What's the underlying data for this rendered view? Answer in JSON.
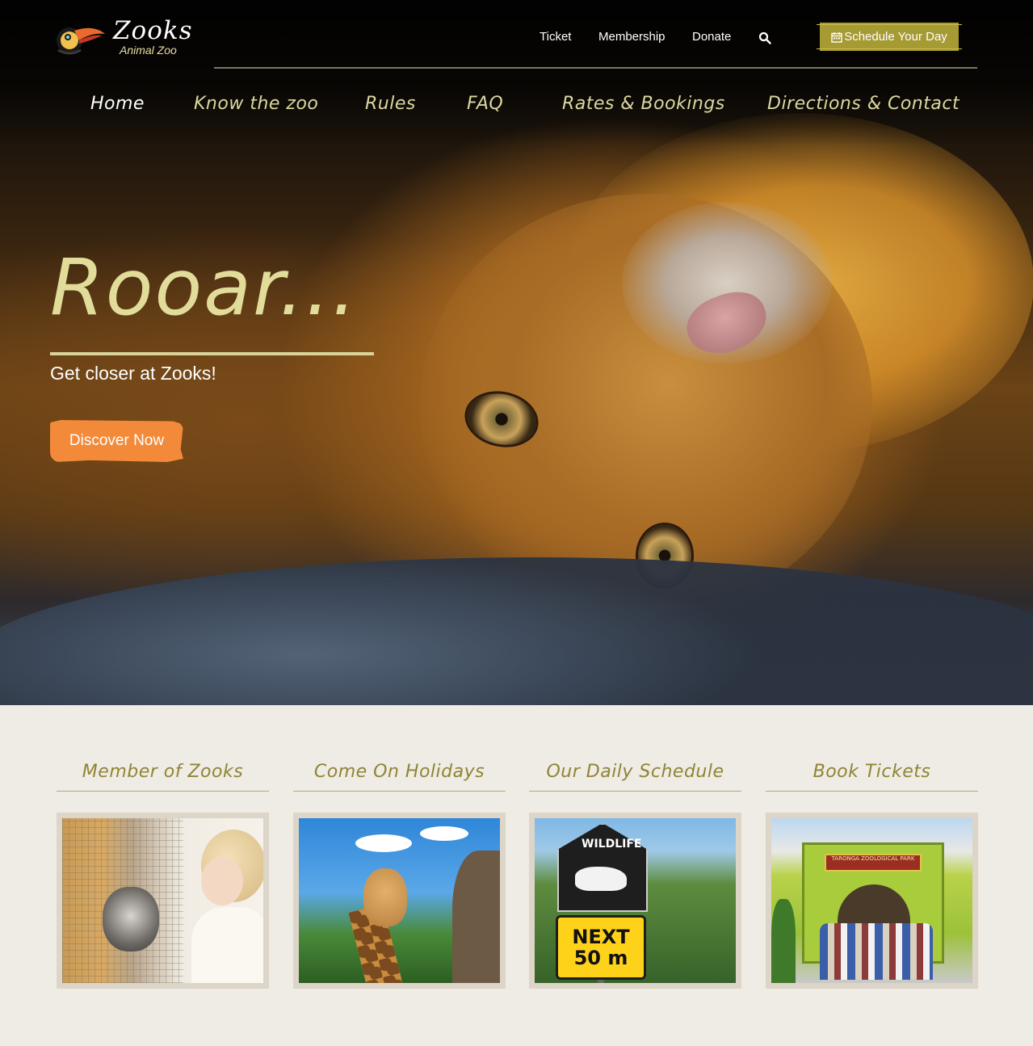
{
  "brand": {
    "name": "Zooks",
    "subtitle": "Animal Zoo"
  },
  "top_nav": {
    "items": [
      {
        "label": "Ticket"
      },
      {
        "label": "Membership"
      },
      {
        "label": "Donate"
      }
    ],
    "search_icon": "search-icon",
    "cta": {
      "label": "Schedule Your Day",
      "icon": "calendar-icon"
    }
  },
  "main_nav": {
    "items": [
      {
        "label": "Home",
        "active": true
      },
      {
        "label": "Know the zoo"
      },
      {
        "label": "Rules"
      },
      {
        "label": "FAQ"
      },
      {
        "label": "Rates & Bookings"
      },
      {
        "label": "Directions & Contact"
      }
    ]
  },
  "hero": {
    "headline": "Rooar...",
    "tagline": "Get closer at Zooks!",
    "button": "Discover Now"
  },
  "features": [
    {
      "title": "Member of Zooks"
    },
    {
      "title": "Come On Holidays"
    },
    {
      "title": "Our Daily Schedule",
      "image_text": [
        "WILDLIFE",
        "NEXT",
        "50 m"
      ]
    },
    {
      "title": "Book Tickets",
      "image_text": "TARONGA ZOOLOGICAL PARK"
    }
  ],
  "colors": {
    "accent_olive": "#a69a33",
    "nav_text": "#dcd8a0",
    "headline": "#e2dc9a",
    "cta_orange": "#f28a3a",
    "section_bg": "#efebe5",
    "card_title": "#8f8534"
  }
}
